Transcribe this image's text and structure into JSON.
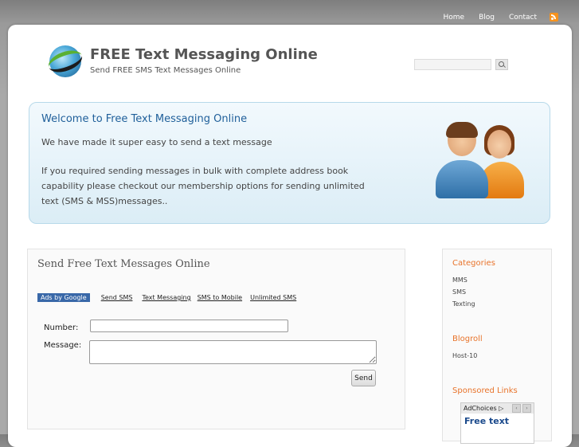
{
  "topnav": {
    "home": "Home",
    "blog": "Blog",
    "contact": "Contact"
  },
  "site": {
    "title": "FREE Text Messaging Online",
    "description": "Send FREE SMS Text Messages Online"
  },
  "search": {
    "placeholder": ""
  },
  "welcome": {
    "heading": "Welcome to Free Text Messaging Online",
    "p1": "We have made it super easy to send a text message",
    "p2": "If you required sending messages in bulk with complete address book capability please checkout our membership options for sending unlimited text (SMS & MSS)messages.."
  },
  "main": {
    "heading": "Send Free Text Messages Online",
    "ads_by": "Ads by Google",
    "ad_links": [
      "Send SMS",
      "Text Messaging",
      "SMS to Mobile",
      "Unlimited SMS"
    ],
    "number_label": "Number:",
    "message_label": "Message:",
    "number_value": "",
    "message_value": "",
    "send_label": "Send"
  },
  "sidebar": {
    "categories_heading": "Categories",
    "categories": [
      "MMS",
      "SMS",
      "Texting"
    ],
    "blogroll_heading": "Blogroll",
    "blogroll": [
      "Host-10"
    ],
    "sponsored_heading": "Sponsored Links",
    "adchoices_label": "AdChoices ▷",
    "ad_text": "Free text"
  },
  "colors": {
    "accent_orange": "#e8732a",
    "link_blue": "#1f5f9a",
    "ads_blue": "#3968a8"
  }
}
